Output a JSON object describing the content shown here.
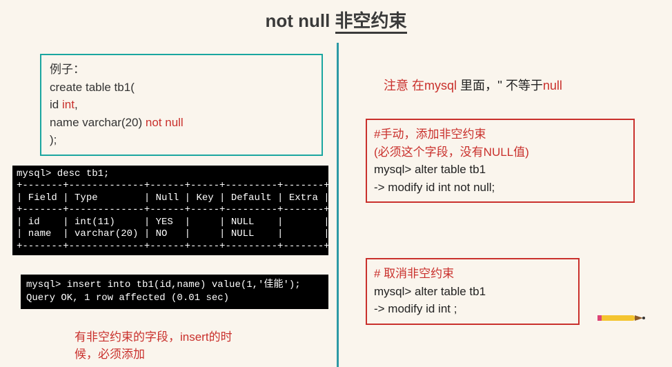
{
  "title": {
    "plain": "not null ",
    "underlined": "非空约束"
  },
  "example": {
    "line1": "例子：",
    "line2a": "create table tb1(",
    "line3a": "    id ",
    "line3kw": "int",
    "line3b": ",",
    "line4a": "    name varchar(20) ",
    "line4kw": "not null",
    "line5": ");"
  },
  "term1": "mysql> desc tb1;\n+-------+-------------+------+-----+---------+-------+\n| Field | Type        | Null | Key | Default | Extra |\n+-------+-------------+------+-----+---------+-------+\n| id    | int(11)     | YES  |     | NULL    |       |\n| name  | varchar(20) | NO   |     | NULL    |       |\n+-------+-------------+------+-----+---------+-------+",
  "term2": "mysql> insert into tb1(id,name) value(1,'佳能');\nQuery OK, 1 row affected (0.01 sec)",
  "bottom_note": {
    "a": "有非空约束的字段，",
    "b": "insert",
    "c": "的时\n候，必须添加"
  },
  "warn": {
    "a": "注意   在",
    "b": "mysql ",
    "c": "里面，'' 不等于",
    "d": "null"
  },
  "box1": {
    "h1": "#手动，添加非空约束",
    "h2": "(必须这个字段，没有NULL值)",
    "c1": "mysql> alter table tb1",
    "c2": "    -> modify id int not null;"
  },
  "box2": {
    "h1": "# 取消非空约束",
    "c1": "mysql> alter table tb1",
    "c2": "    -> modify id int ;"
  }
}
